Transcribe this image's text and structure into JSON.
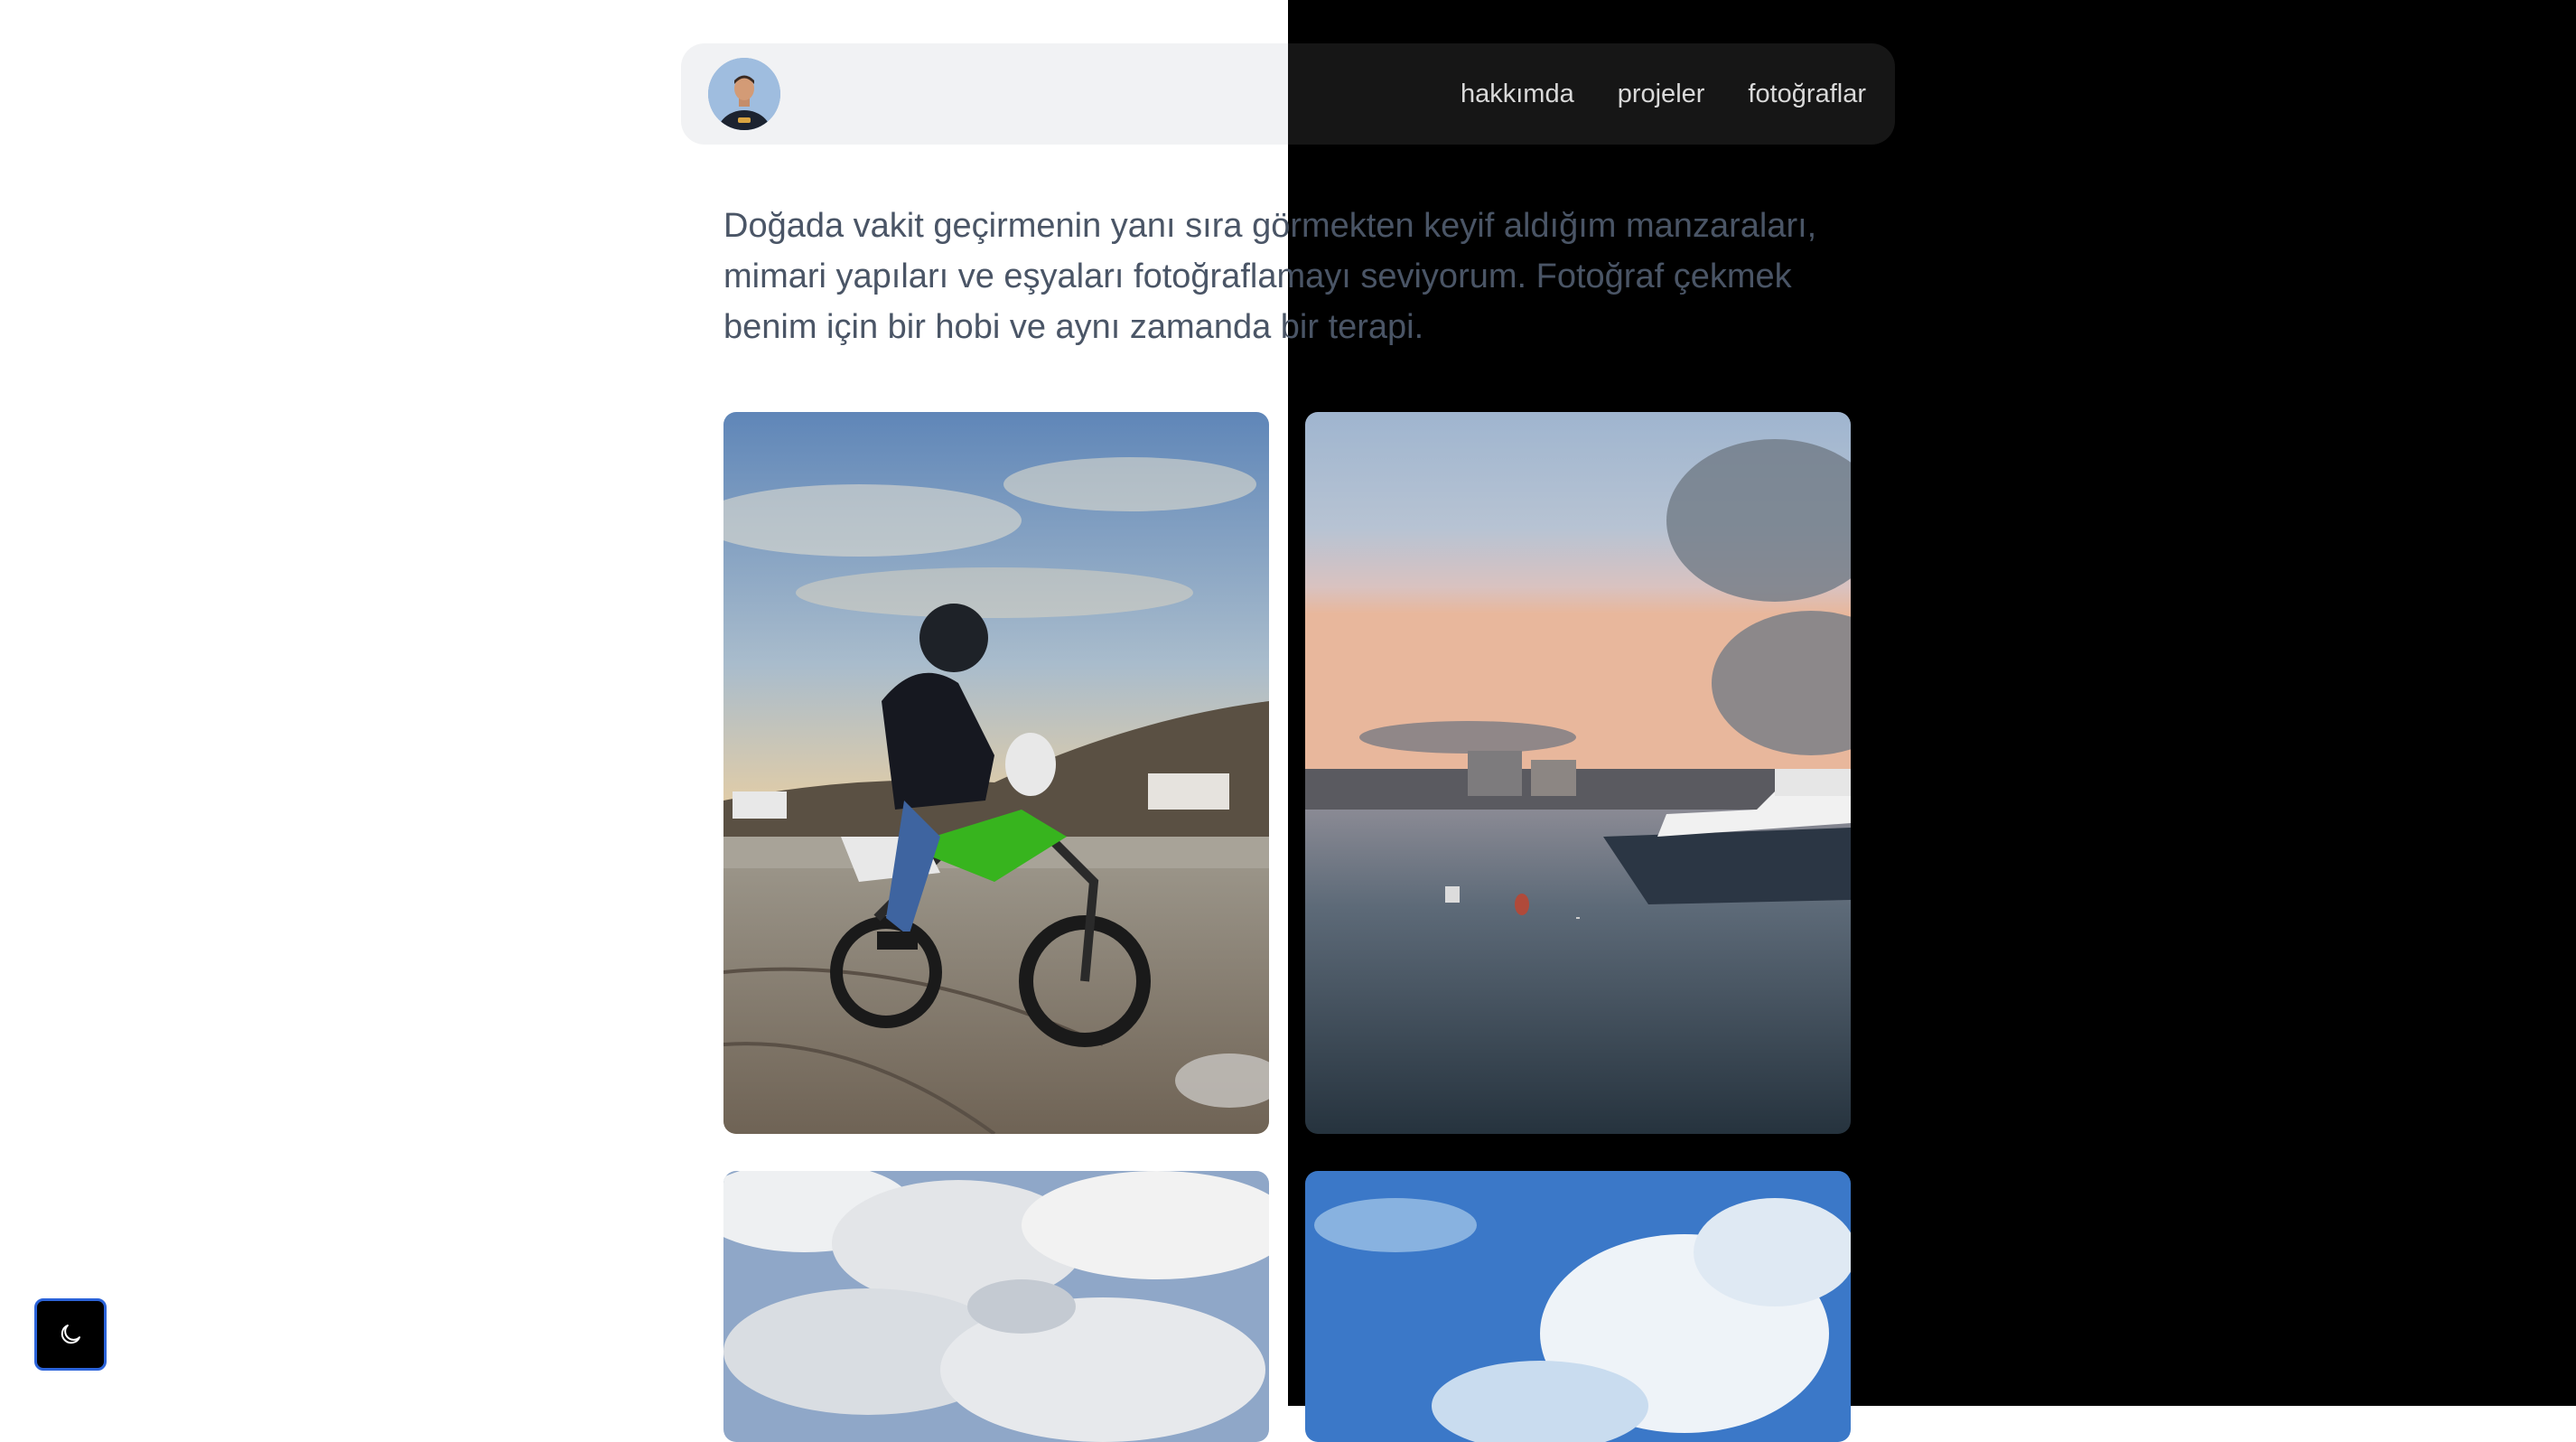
{
  "nav": {
    "items": [
      {
        "label": "hakkımda"
      },
      {
        "label": "projeler"
      },
      {
        "label": "fotoğraflar"
      }
    ]
  },
  "intro": {
    "line1": "Doğada vakit geçirmenin yanı sıra görmekten keyif aldığım manzaraları,",
    "line2": "mimari yapıları ve eşyaları fotoğraflamayı seviyorum. Fotoğraf çekmek",
    "line3": "benim için bir hobi ve aynı zamanda bir terapi."
  },
  "photos": [
    {
      "subject": "motorcycle-rider-on-beach"
    },
    {
      "subject": "sunset-harbor-with-boat"
    },
    {
      "subject": "cloudy-sky"
    },
    {
      "subject": "blue-sky-clouds"
    }
  ],
  "theme_toggle": {
    "icon": "moon-icon"
  },
  "colors": {
    "dark_background": "#000000",
    "light_background": "#ffffff",
    "toggle_border": "#2b63d9"
  }
}
